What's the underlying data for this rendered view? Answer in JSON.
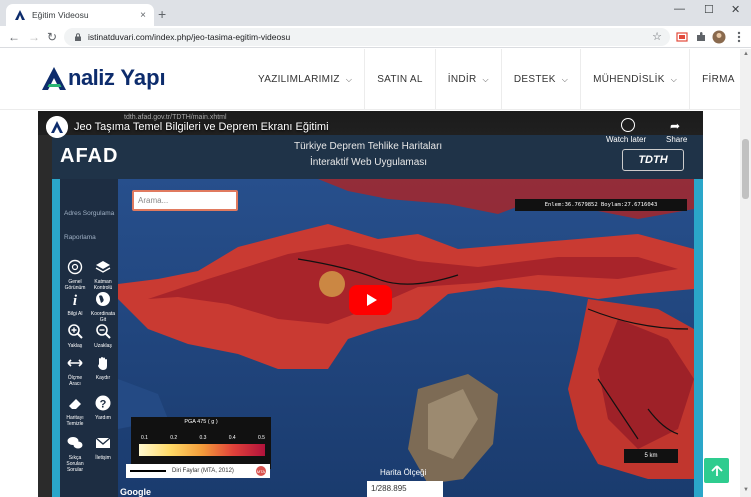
{
  "browser": {
    "tab_title": "Eğitim Videosu",
    "tab_close": "×",
    "new_tab": "+",
    "url": "istinatduvari.com/index.php/jeo-tasima-egitim-videosu",
    "win_minimize": "—",
    "win_maximize": "☐",
    "win_close": "✕",
    "back": "←",
    "forward": "→",
    "reload": "↻",
    "star": "☆"
  },
  "site": {
    "logo_text1": "naliz",
    "logo_text2": "Yapı",
    "nav": [
      {
        "label": "YAZILIMLARIMIZ"
      },
      {
        "label": "SATIN AL"
      },
      {
        "label": "İNDİR"
      },
      {
        "label": "DESTEK"
      },
      {
        "label": "MÜHENDİSLİK"
      },
      {
        "label": "FİRMA"
      }
    ]
  },
  "video": {
    "title": "Jeo Taşıma Temel Bilgileri ve Deprem Ekranı Eğitimi",
    "url_hint": "tdth.afad.gov.tr/TDTH/main.xhtml",
    "watch_later": "Watch later",
    "share": "Share"
  },
  "app": {
    "afad_logo": "AFAD",
    "title1": "Türkiye Deprem Tehlike Haritaları",
    "title2": "İnteraktif Web Uygulaması",
    "tdth_logo": "TDTH",
    "sidebar_sections": [
      "Adres Sorgulama",
      "Raporlama"
    ],
    "tools": [
      {
        "label": "Genel Görünüm"
      },
      {
        "label": "Katman Kontrolü"
      },
      {
        "label": "Bilgi Al"
      },
      {
        "label": "Koordinata Git"
      },
      {
        "label": "Yaklaş"
      },
      {
        "label": "Uzaklaş"
      },
      {
        "label": "Ölçme Aracı"
      },
      {
        "label": "Kaydır"
      },
      {
        "label": "Haritayı Temizle"
      },
      {
        "label": "Yardım"
      },
      {
        "label": "Sıkça Sorulan Sorular"
      },
      {
        "label": "İletişim"
      }
    ],
    "search_placeholder": "Arama...",
    "coordinates": "Enlem:36.7679852 Boylam:27.6716043",
    "legend_title": "PGA 475 ( g )",
    "legend_ticks": [
      "0.1",
      "0.2",
      "0.3",
      "0.4",
      "0.5"
    ],
    "faults_label": "Diri Faylar (MTA, 2012)",
    "faults_badge": "MTA",
    "scale_label": "5 km",
    "scale_title": "Harita Ölçeği",
    "scale_value": "1/288.895",
    "google": "Google"
  },
  "colors": {
    "brand_navy": "#0d2c6c",
    "brand_green": "#2bb673",
    "play_red": "#ff0000",
    "to_top": "#2ecc8f"
  }
}
